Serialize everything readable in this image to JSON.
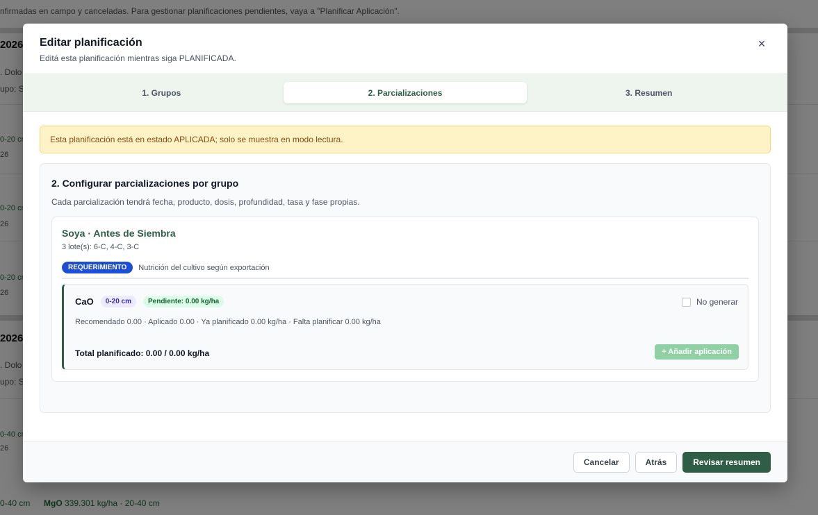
{
  "background": {
    "top_text": "nfirmadas en campo y canceladas. Para gestionar planificaciones pendientes, vaya a \"Planificar Aplicación\".",
    "year1": "2026",
    "year2": "2026",
    "frag_dolo": ". Dolo",
    "frag_grupo": "upo: S",
    "depth_0_20": "0-20 cm",
    "depth_20_40": "0-40 cm",
    "frag_26": "26",
    "bottom_depth": "0-40 cm",
    "bottom_nutrient": "MgO",
    "bottom_value": "339.301 kg/ha · 20-40 cm"
  },
  "modal": {
    "title": "Editar planificación",
    "subtitle": "Editá esta planificación mientras siga PLANIFICADA.",
    "close_label": "×",
    "steps": [
      {
        "label": "1. Grupos"
      },
      {
        "label": "2. Parcializaciones"
      },
      {
        "label": "3. Resumen"
      }
    ],
    "alert": "Esta planificación está en estado APLICADA; solo se muestra en modo lectura.",
    "section": {
      "title": "2. Configurar parcializaciones por grupo",
      "description": "Cada parcialización tendrá fecha, producto, dosis, profundidad, tasa y fase propias."
    },
    "group": {
      "title": "Soya · Antes de Siembra",
      "lots": "3 lote(s): 6-C, 4-C, 3-C",
      "badge": "REQUERIMIENTO",
      "badge_desc": "Nutrición del cultivo según exportación",
      "nutrient": {
        "name": "CaO",
        "depth": "0-20 cm",
        "pending": "Pendiente: 0.00 kg/ha",
        "no_generate_label": "No generar",
        "stats": "Recomendado 0.00 · Aplicado 0.00 · Ya planificado 0.00 kg/ha · Falta planificar 0.00 kg/ha",
        "total": "Total planificado: 0.00 / 0.00 kg/ha",
        "add_label": "+ Añadir aplicación"
      }
    },
    "footer": {
      "cancel": "Cancelar",
      "back": "Atrás",
      "next": "Revisar resumen"
    }
  }
}
